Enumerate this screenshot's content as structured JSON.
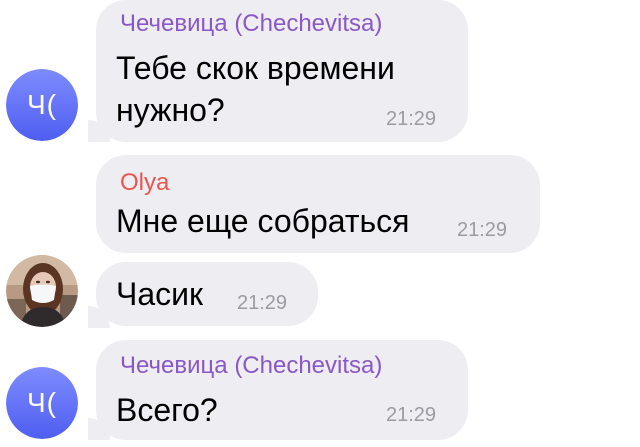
{
  "colors": {
    "bubble": "#eeeef2",
    "chechevitsa_name": "#8a57c7",
    "olya_name": "#e8554e",
    "avatar_gradient_top": "#7e8cff",
    "avatar_gradient_bottom": "#4f5ef0",
    "time": "#9b9ba3"
  },
  "messages": [
    {
      "sender": "Чечевица (Chechevitsa)",
      "lines": [
        "Тебе скок времени",
        "нужно?"
      ],
      "time": "21:29",
      "avatar": {
        "type": "initials",
        "text": "Ч("
      }
    },
    {
      "sender": "Olya",
      "lines": [
        "Мне еще собраться"
      ],
      "time": "21:29"
    },
    {
      "lines": [
        "Часик"
      ],
      "time": "21:29",
      "avatar": {
        "type": "photo",
        "icon": "user-photo-icon"
      }
    },
    {
      "sender": "Чечевица (Chechevitsa)",
      "lines": [
        "Всего?"
      ],
      "time": "21:29",
      "avatar": {
        "type": "initials",
        "text": "Ч("
      }
    }
  ]
}
